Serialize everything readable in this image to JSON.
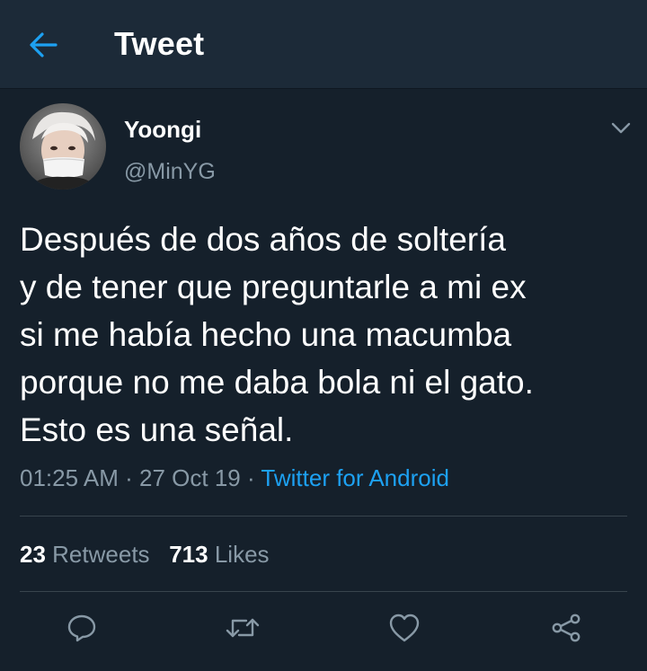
{
  "header": {
    "title": "Tweet",
    "back_icon": "arrow-left-icon"
  },
  "tweet": {
    "author_name": "Yoongi",
    "author_handle": "@MinYG",
    "text_lines": [
      "Después de dos años de soltería",
      "y de tener que preguntarle a mi ex",
      "si me había hecho una macumba",
      "porque no me daba bola ni el gato.",
      "Esto es una señal."
    ],
    "time": "01:25 AM",
    "date": "27 Oct 19",
    "separator": "·",
    "source": "Twitter for Android",
    "retweets_count": "23",
    "retweets_label": "Retweets",
    "likes_count": "713",
    "likes_label": "Likes"
  },
  "actions": {
    "icons": [
      "reply-icon",
      "retweet-icon",
      "like-icon",
      "share-icon"
    ]
  },
  "colors": {
    "background": "#15202b",
    "header_background": "#1c2a38",
    "accent": "#1da1f2",
    "secondary_text": "#8899a6",
    "divider": "#38444d"
  }
}
